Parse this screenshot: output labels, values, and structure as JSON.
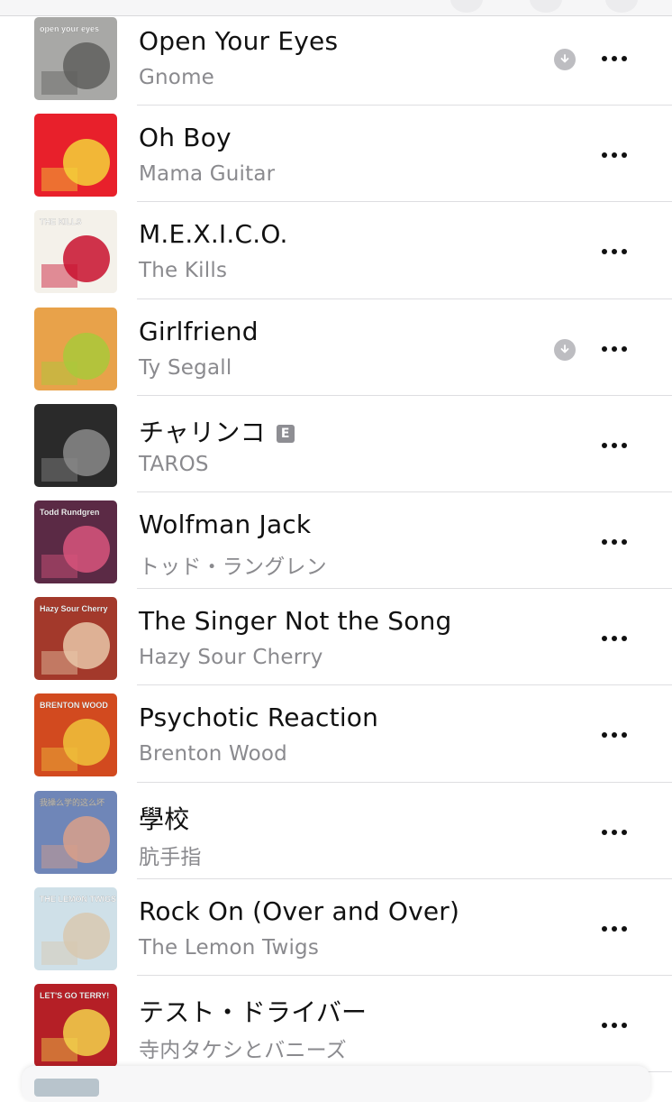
{
  "songs": [
    {
      "title": "Open Your Eyes",
      "artist": "Gnome",
      "downloaded": true,
      "explicit": false,
      "art_icon": "album-art-open-your-eyes",
      "art_colors": [
        "#a8a8a6",
        "#5f5f5d"
      ],
      "art_text": "open your eyes"
    },
    {
      "title": "Oh Boy",
      "artist": "Mama Guitar",
      "downloaded": false,
      "explicit": false,
      "art_icon": "album-art-oh-boy",
      "art_colors": [
        "#e8202b",
        "#f3d23a"
      ],
      "art_text": ""
    },
    {
      "title": "M.E.X.I.C.O.",
      "artist": "The Kills",
      "downloaded": false,
      "explicit": false,
      "art_icon": "album-art-midnight-boom",
      "art_colors": [
        "#f4f1ea",
        "#c8102e"
      ],
      "art_text": "THE KILLS"
    },
    {
      "title": "Girlfriend",
      "artist": "Ty Segall",
      "downloaded": true,
      "explicit": false,
      "art_icon": "album-art-melted",
      "art_colors": [
        "#e8a24a",
        "#a9c93a"
      ],
      "art_text": ""
    },
    {
      "title": "チャリンコ",
      "artist": "TAROS",
      "downloaded": false,
      "explicit": true,
      "art_icon": "album-art-taros",
      "art_colors": [
        "#2a2a2a",
        "#8a8a8a"
      ],
      "art_text": ""
    },
    {
      "title": "Wolfman Jack",
      "artist": "トッド・ラングレン",
      "downloaded": false,
      "explicit": false,
      "art_icon": "album-art-something-anything",
      "art_colors": [
        "#5b2a45",
        "#d8557c"
      ],
      "art_text": "Todd Rundgren"
    },
    {
      "title": "The Singer Not the Song",
      "artist": "Hazy Sour Cherry",
      "downloaded": false,
      "explicit": false,
      "art_icon": "album-art-hazy-sour-cherry",
      "art_colors": [
        "#a3392b",
        "#e9c7a8"
      ],
      "art_text": "Hazy Sour Cherry"
    },
    {
      "title": "Psychotic Reaction",
      "artist": "Brenton Wood",
      "downloaded": false,
      "explicit": false,
      "art_icon": "album-art-brenton-wood",
      "art_colors": [
        "#d24a1f",
        "#f0c23b"
      ],
      "art_text": "BRENTON WOOD"
    },
    {
      "title": "學校",
      "artist": "肮手指",
      "downloaded": false,
      "explicit": false,
      "art_icon": "album-art-school",
      "art_colors": [
        "#6f86b8",
        "#d9a08a"
      ],
      "art_text": "我操么学的这么坏"
    },
    {
      "title": "Rock On (Over and Over)",
      "artist": "The Lemon Twigs",
      "downloaded": false,
      "explicit": false,
      "art_icon": "album-art-lemon-twigs",
      "art_colors": [
        "#cfe0e8",
        "#d8c8b0"
      ],
      "art_text": "THE LEMON TWIGS"
    },
    {
      "title": "テスト・ドライバー",
      "artist": "寺内タケシとバニーズ",
      "downloaded": false,
      "explicit": false,
      "art_icon": "album-art-lets-go-terry",
      "art_colors": [
        "#b51f26",
        "#f2d24b"
      ],
      "art_text": "LET'S GO TERRY!"
    }
  ],
  "explicit_badge": "E",
  "icons": {
    "more": "more-options-icon",
    "download": "downloaded-icon"
  }
}
